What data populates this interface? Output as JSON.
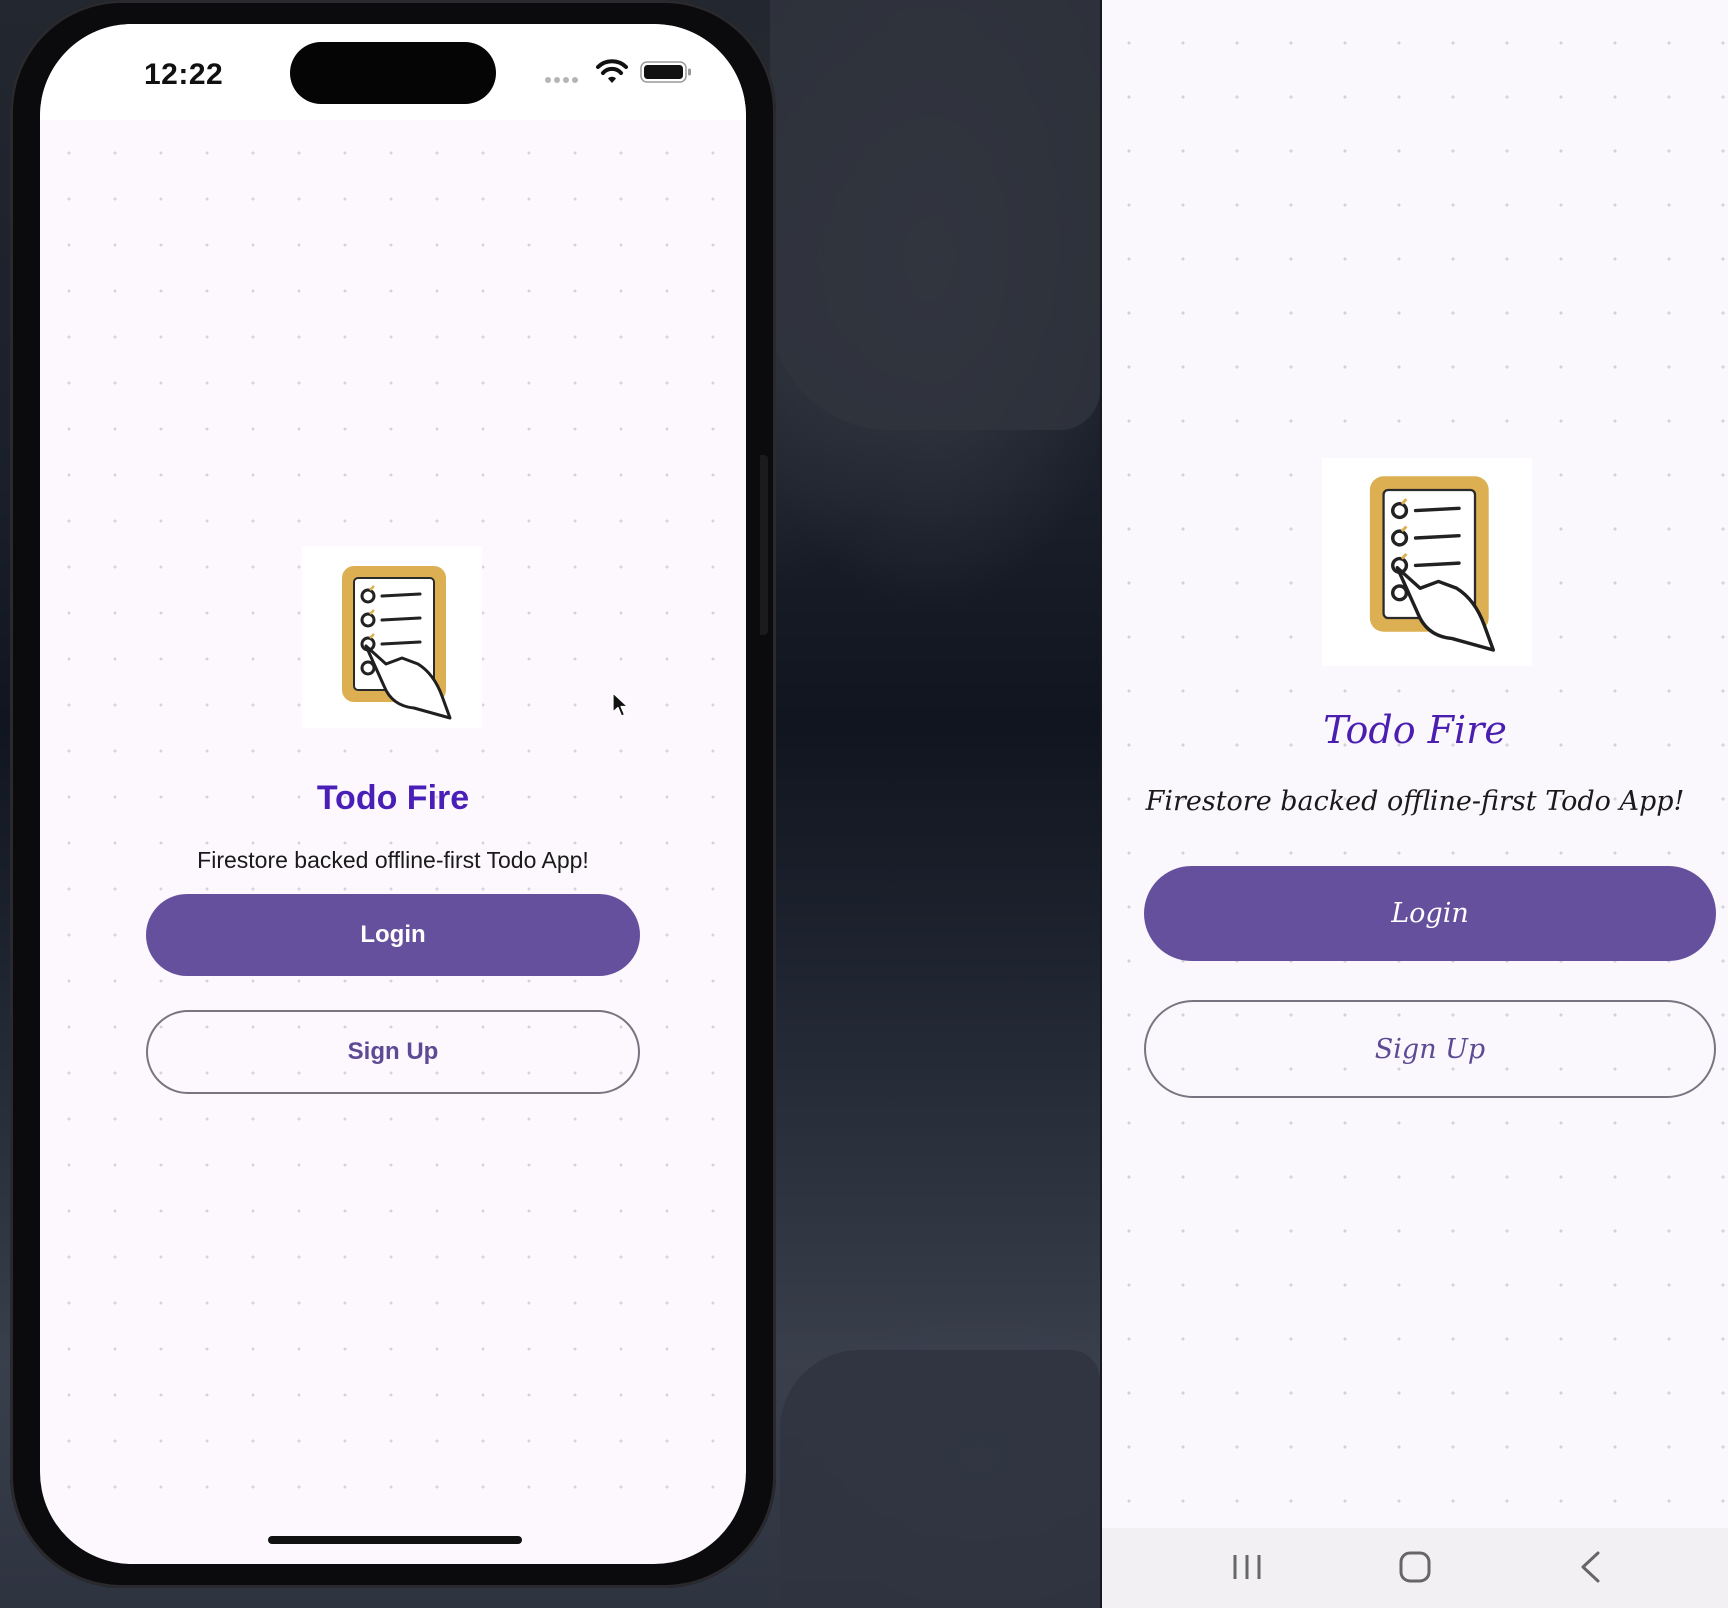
{
  "ios": {
    "status_bar": {
      "time": "12:22"
    },
    "app": {
      "title": "Todo Fire",
      "subtitle": "Firestore backed offline-first Todo App!",
      "login_label": "Login",
      "signup_label": "Sign Up"
    }
  },
  "android": {
    "app": {
      "title": "Todo Fire",
      "subtitle": "Firestore backed offline-first Todo App!",
      "login_label": "Login",
      "signup_label": "Sign Up"
    },
    "nav": {
      "icons": [
        "recents-icon",
        "home-icon",
        "back-icon"
      ]
    }
  },
  "colors": {
    "primary": "#65509e",
    "title": "#4a1fb8",
    "logo_clipboard": "#dcb052",
    "background": "#fcf8fd"
  }
}
